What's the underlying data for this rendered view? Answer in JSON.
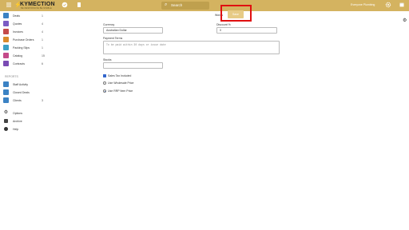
{
  "topbar": {
    "logo": "KYMECTION",
    "logo_sub": "BE RESPONSIVE BE NIMBLE",
    "search_label": "Search",
    "user_label": "Everyone Plumbing"
  },
  "sidebar": {
    "items": [
      {
        "label": "Deals",
        "count": "1",
        "color": "#3b82c4"
      },
      {
        "label": "Quotes",
        "count": "4",
        "color": "#7a5bc4"
      },
      {
        "label": "Invoices",
        "count": "4",
        "color": "#c44a4a"
      },
      {
        "label": "Purchase Orders",
        "count": "1",
        "color": "#d98a2b"
      },
      {
        "label": "Packing Slips",
        "count": "1",
        "color": "#3b9fc4"
      },
      {
        "label": "Catalog",
        "count": "15",
        "color": "#c44a8a"
      },
      {
        "label": "Contracts",
        "count": "6",
        "color": "#7a4bb4"
      }
    ],
    "section_label": "REPORTS",
    "report_items": [
      {
        "label": "Staff Activity",
        "count": ""
      },
      {
        "label": "Closed Deals",
        "count": ""
      },
      {
        "label": "Clients",
        "count": "3"
      }
    ],
    "bottom_items": [
      {
        "label": "Options"
      },
      {
        "label": "Archive"
      },
      {
        "label": "Help"
      }
    ]
  },
  "form": {
    "currency_label": "Currency",
    "currency_value": "Australian Dollar",
    "discount_label": "Discount %",
    "discount_value": "0",
    "payment_terms_label": "Payment Terms",
    "payment_terms_placeholder": "To be paid within 30 days or issue date",
    "stocks_label": "Stocks",
    "stocks_value": "",
    "tax_included_label": "Sales Tax Included",
    "wholesale_label": "Use Wholesale Price",
    "rrp_label": "Use RRP Item Price",
    "save_label": "Save",
    "top_label": "Words"
  }
}
